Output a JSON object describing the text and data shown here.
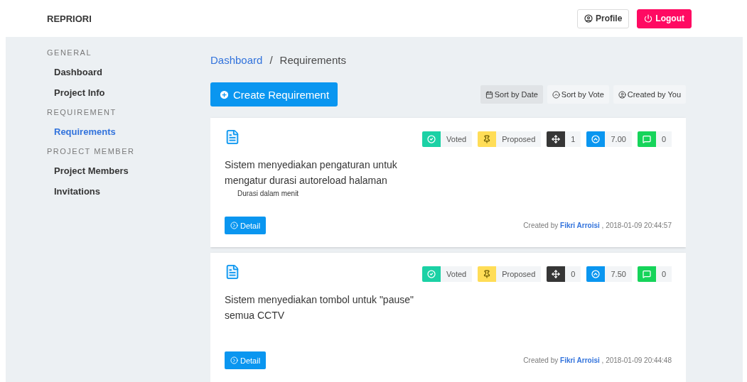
{
  "brand": "REPRIORI",
  "header_buttons": [
    {
      "kind": "profile",
      "label": "Profile"
    },
    {
      "kind": "logout",
      "label": "Logout"
    }
  ],
  "sidebar": [
    {
      "title": "GENERAL",
      "items": [
        {
          "label": "Dashboard",
          "selected": false
        },
        {
          "label": "Project Info",
          "selected": false
        }
      ]
    },
    {
      "title": "REQUIREMENT",
      "items": [
        {
          "label": "Requirements",
          "selected": true
        }
      ]
    },
    {
      "title": "PROJECT MEMBER",
      "items": [
        {
          "label": "Project Members",
          "selected": false
        },
        {
          "label": "Invitations",
          "selected": false
        }
      ]
    }
  ],
  "breadcrumb": [
    {
      "label": "Dashboard",
      "link": true
    },
    {
      "label": "/",
      "link": false
    },
    {
      "label": "Requirements",
      "link": false
    }
  ],
  "create_button": "Create Requirement",
  "sort_buttons": [
    {
      "kind": "date",
      "label": "Sort by Date",
      "selected": true
    },
    {
      "kind": "vote",
      "label": "Sort by Vote",
      "selected": false
    },
    {
      "kind": "user",
      "label": "Created by You",
      "selected": false
    }
  ],
  "requirements": [
    {
      "title": "Sistem menyediakan pengaturan untuk mengatur durasi autoreload halaman",
      "note": "Durasi dalam menit",
      "tags": [
        {
          "kind": "voted",
          "label": "Voted"
        },
        {
          "kind": "status",
          "label": "Proposed"
        },
        {
          "kind": "dependency",
          "label": "1"
        },
        {
          "kind": "score",
          "label": "7.00"
        },
        {
          "kind": "comments",
          "label": "0"
        }
      ],
      "detail": "Detail",
      "created_prefix": "Created by",
      "author": "Fikri Arroisi",
      "created_suffix": ", 2018-01-09 20:44:57"
    },
    {
      "title": "Sistem menyediakan tombol untuk \"pause\" semua CCTV",
      "tags": [
        {
          "kind": "voted",
          "label": "Voted"
        },
        {
          "kind": "status",
          "label": "Proposed"
        },
        {
          "kind": "dependency",
          "label": "0"
        },
        {
          "kind": "score",
          "label": "7.50"
        },
        {
          "kind": "comments",
          "label": "0"
        }
      ],
      "detail": "Detail",
      "created_prefix": "Created by",
      "author": "Fikri Arroisi",
      "created_suffix": ", 2018-01-09 20:44:48"
    }
  ]
}
